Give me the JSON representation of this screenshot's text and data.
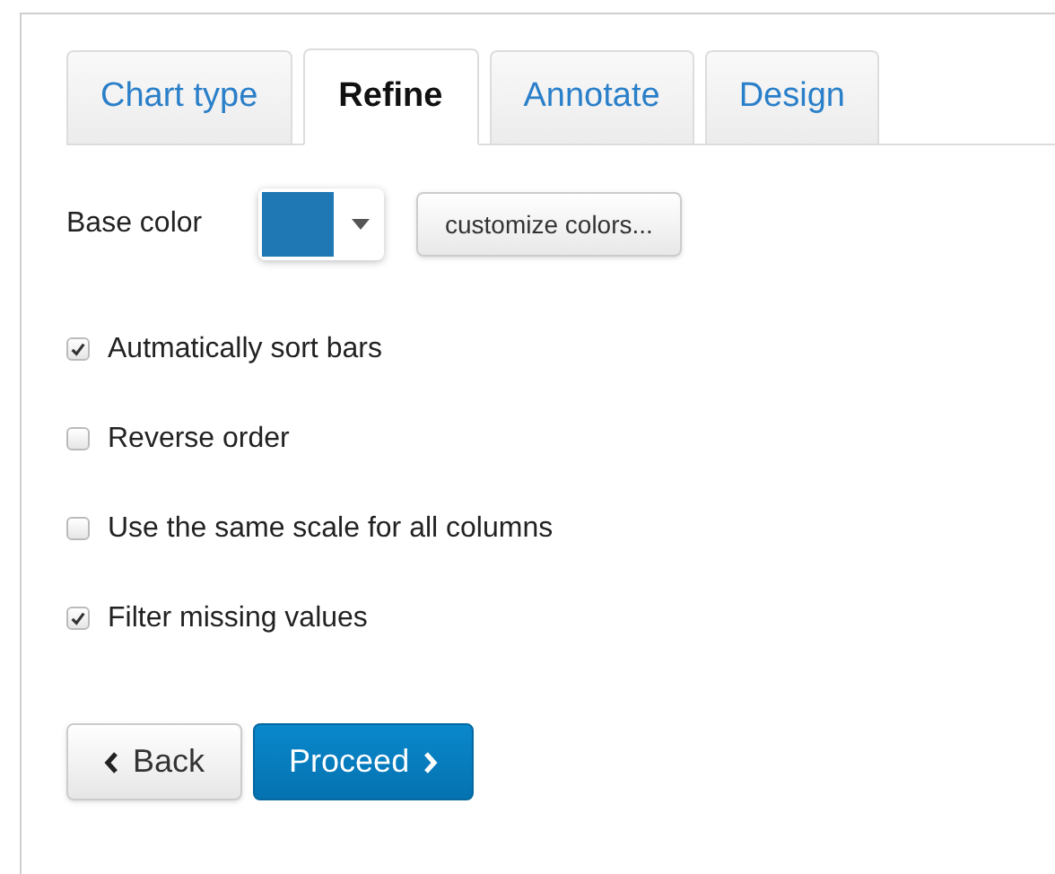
{
  "tabs": [
    {
      "label": "Chart type",
      "selected": false
    },
    {
      "label": "Refine",
      "selected": true
    },
    {
      "label": "Annotate",
      "selected": false
    },
    {
      "label": "Design",
      "selected": false
    }
  ],
  "base_color": {
    "label": "Base color",
    "color": "#1f77b4",
    "button": "customize colors..."
  },
  "options": [
    {
      "label": "Autmatically sort bars",
      "checked": true
    },
    {
      "label": "Reverse order",
      "checked": false
    },
    {
      "label": "Use the same scale for all columns",
      "checked": false
    },
    {
      "label": "Filter missing values",
      "checked": true
    }
  ],
  "buttons": [
    {
      "label": "Back",
      "kind": "back"
    },
    {
      "label": "Proceed",
      "kind": "proceed"
    }
  ]
}
